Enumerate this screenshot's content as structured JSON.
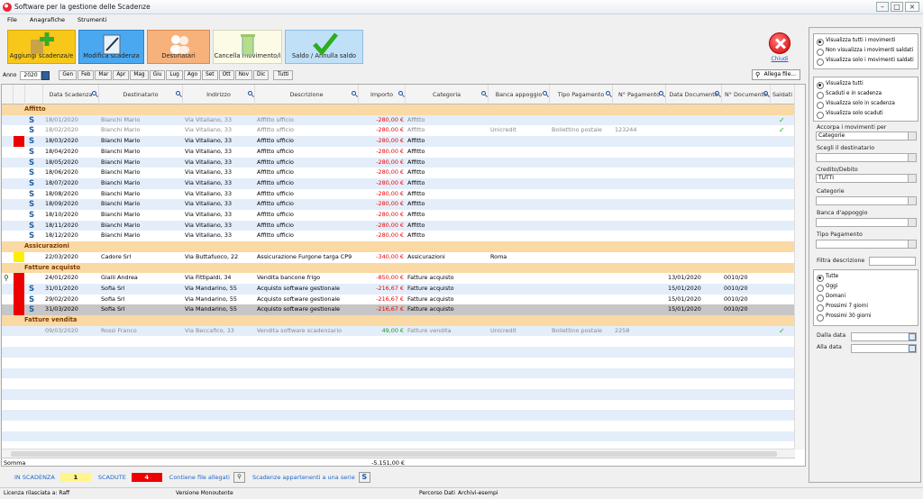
{
  "window": {
    "title": "Software per la gestione delle Scadenze"
  },
  "menu": [
    "File",
    "Anagrafiche",
    "Strumenti"
  ],
  "toolbar": {
    "add": "Aggiungi scadenza/e",
    "edit": "Modifica scadenza",
    "recipients": "Destinatari",
    "delete": "Cancella movimento/i",
    "settle": "Saldo / Annulla saldo",
    "close": "Chiudi"
  },
  "yearbar": {
    "label": "Anno",
    "year": "2020",
    "months": [
      "Gen",
      "Feb",
      "Mar",
      "Apr",
      "Mag",
      "Giu",
      "Lug",
      "Ago",
      "Set",
      "Ott",
      "Nov",
      "Dic"
    ],
    "all": "Tutti",
    "attach": "Allega file..."
  },
  "columns": [
    "Data Scadenza",
    "Destinatario",
    "Indirizzo",
    "Descrizione",
    "Importo",
    "Categoria",
    "Banca appoggio",
    "Tipo Pagamento",
    "N° Pagamento",
    "Data Documento",
    "N° Documento",
    "Saldati"
  ],
  "groups": [
    "Affitto",
    "Assicurazioni",
    "Fatture acquisto",
    "Fatture vendita"
  ],
  "rows": [
    {
      "g": 0,
      "date": "18/01/2020",
      "dest": "Bianchi Mario",
      "addr": "Via Vitaliano, 33",
      "desc": "Affitto ufficio",
      "amt": "-280,00 €",
      "cat": "Affitto",
      "bank": "",
      "tipo": "",
      "npag": "",
      "ddoc": "",
      "ndoc": "",
      "paid": true,
      "flag": "",
      "series": true
    },
    {
      "g": 0,
      "date": "18/02/2020",
      "dest": "Bianchi Mario",
      "addr": "Via Vitaliano, 33",
      "desc": "Affitto ufficio",
      "amt": "-280,00 €",
      "cat": "Affitto",
      "bank": "Unicredit",
      "tipo": "Bollettino postale",
      "npag": "123244",
      "ddoc": "",
      "ndoc": "",
      "paid": true,
      "flag": "",
      "series": true
    },
    {
      "g": 0,
      "date": "18/03/2020",
      "dest": "Bianchi Mario",
      "addr": "Via Vitaliano, 33",
      "desc": "Affitto ufficio",
      "amt": "-280,00 €",
      "cat": "Affitto",
      "bank": "",
      "tipo": "",
      "npag": "",
      "ddoc": "",
      "ndoc": "",
      "paid": false,
      "flag": "#ee0000",
      "series": true
    },
    {
      "g": 0,
      "date": "18/04/2020",
      "dest": "Bianchi Mario",
      "addr": "Via Vitaliano, 33",
      "desc": "Affitto ufficio",
      "amt": "-280,00 €",
      "cat": "Affitto",
      "bank": "",
      "tipo": "",
      "npag": "",
      "ddoc": "",
      "ndoc": "",
      "paid": false,
      "flag": "",
      "series": true
    },
    {
      "g": 0,
      "date": "18/05/2020",
      "dest": "Bianchi Mario",
      "addr": "Via Vitaliano, 33",
      "desc": "Affitto ufficio",
      "amt": "-280,00 €",
      "cat": "Affitto",
      "bank": "",
      "tipo": "",
      "npag": "",
      "ddoc": "",
      "ndoc": "",
      "paid": false,
      "flag": "",
      "series": true
    },
    {
      "g": 0,
      "date": "18/06/2020",
      "dest": "Bianchi Mario",
      "addr": "Via Vitaliano, 33",
      "desc": "Affitto ufficio",
      "amt": "-280,00 €",
      "cat": "Affitto",
      "bank": "",
      "tipo": "",
      "npag": "",
      "ddoc": "",
      "ndoc": "",
      "paid": false,
      "flag": "",
      "series": true
    },
    {
      "g": 0,
      "date": "18/07/2020",
      "dest": "Bianchi Mario",
      "addr": "Via Vitaliano, 33",
      "desc": "Affitto ufficio",
      "amt": "-280,00 €",
      "cat": "Affitto",
      "bank": "",
      "tipo": "",
      "npag": "",
      "ddoc": "",
      "ndoc": "",
      "paid": false,
      "flag": "",
      "series": true
    },
    {
      "g": 0,
      "date": "18/08/2020",
      "dest": "Bianchi Mario",
      "addr": "Via Vitaliano, 33",
      "desc": "Affitto ufficio",
      "amt": "-280,00 €",
      "cat": "Affitto",
      "bank": "",
      "tipo": "",
      "npag": "",
      "ddoc": "",
      "ndoc": "",
      "paid": false,
      "flag": "",
      "series": true
    },
    {
      "g": 0,
      "date": "18/09/2020",
      "dest": "Bianchi Mario",
      "addr": "Via Vitaliano, 33",
      "desc": "Affitto ufficio",
      "amt": "-280,00 €",
      "cat": "Affitto",
      "bank": "",
      "tipo": "",
      "npag": "",
      "ddoc": "",
      "ndoc": "",
      "paid": false,
      "flag": "",
      "series": true
    },
    {
      "g": 0,
      "date": "18/10/2020",
      "dest": "Bianchi Mario",
      "addr": "Via Vitaliano, 33",
      "desc": "Affitto ufficio",
      "amt": "-280,00 €",
      "cat": "Affitto",
      "bank": "",
      "tipo": "",
      "npag": "",
      "ddoc": "",
      "ndoc": "",
      "paid": false,
      "flag": "",
      "series": true
    },
    {
      "g": 0,
      "date": "18/11/2020",
      "dest": "Bianchi Mario",
      "addr": "Via Vitaliano, 33",
      "desc": "Affitto ufficio",
      "amt": "-280,00 €",
      "cat": "Affitto",
      "bank": "",
      "tipo": "",
      "npag": "",
      "ddoc": "",
      "ndoc": "",
      "paid": false,
      "flag": "",
      "series": true
    },
    {
      "g": 0,
      "date": "18/12/2020",
      "dest": "Bianchi Mario",
      "addr": "Via Vitaliano, 33",
      "desc": "Affitto ufficio",
      "amt": "-280,00 €",
      "cat": "Affitto",
      "bank": "",
      "tipo": "",
      "npag": "",
      "ddoc": "",
      "ndoc": "",
      "paid": false,
      "flag": "",
      "series": true
    },
    {
      "g": 1,
      "date": "22/03/2020",
      "dest": "Cadore Srl",
      "addr": "Via Buttafuoco, 22",
      "desc": "Assicurazione Furgone targa CP9",
      "amt": "-340,00 €",
      "cat": "Assicurazioni",
      "bank": "Roma",
      "tipo": "",
      "npag": "",
      "ddoc": "",
      "ndoc": "",
      "paid": false,
      "flag": "#ffee00",
      "series": false
    },
    {
      "g": 2,
      "date": "24/01/2020",
      "dest": "Gialli Andrea",
      "addr": "Via Fittipaldi, 34",
      "desc": "Vendita bancone frigo",
      "amt": "-850,00 €",
      "cat": "Fatture acquisto",
      "bank": "",
      "tipo": "",
      "npag": "",
      "ddoc": "13/01/2020",
      "ndoc": "0010/20",
      "paid": false,
      "flag": "#ee0000",
      "series": false,
      "attach": true
    },
    {
      "g": 2,
      "date": "31/01/2020",
      "dest": "Sofia Srl",
      "addr": "Via Mandarino, 55",
      "desc": "Acquisto software gestionale",
      "amt": "-216,67 €",
      "cat": "Fatture acquisto",
      "bank": "",
      "tipo": "",
      "npag": "",
      "ddoc": "15/01/2020",
      "ndoc": "0010/20",
      "paid": false,
      "flag": "#ee0000",
      "series": true
    },
    {
      "g": 2,
      "date": "29/02/2020",
      "dest": "Sofia Srl",
      "addr": "Via Mandarino, 55",
      "desc": "Acquisto software gestionale",
      "amt": "-216,67 €",
      "cat": "Fatture acquisto",
      "bank": "",
      "tipo": "",
      "npag": "",
      "ddoc": "15/01/2020",
      "ndoc": "0010/20",
      "paid": false,
      "flag": "#ee0000",
      "series": true
    },
    {
      "g": 2,
      "date": "31/03/2020",
      "dest": "Sofia Srl",
      "addr": "Via Mandarino, 55",
      "desc": "Acquisto software gestionale",
      "amt": "-216,67 €",
      "cat": "Fatture acquisto",
      "bank": "",
      "tipo": "",
      "npag": "",
      "ddoc": "15/01/2020",
      "ndoc": "0010/20",
      "paid": false,
      "flag": "#ee0000",
      "series": true,
      "selected": true
    },
    {
      "g": 3,
      "date": "09/03/2020",
      "dest": "Rossi Franco",
      "addr": "Via Beccafico, 33",
      "desc": "Vendita software scadenzario",
      "amt": "49,00 €",
      "cat": "Fatture vendita",
      "bank": "Unicredit",
      "tipo": "Bollettino postale",
      "npag": "2258",
      "ddoc": "",
      "ndoc": "",
      "paid": true,
      "flag": "",
      "series": false,
      "positive": true
    }
  ],
  "sum": {
    "label": "Somma",
    "value": "-5.151,00 €"
  },
  "legend": {
    "due": "IN SCADENZA",
    "due_count": "1",
    "expired": "SCADUTE",
    "expired_count": "4",
    "attach": "Contiene file allegati",
    "series": "Scadenze appartenenti a una serie"
  },
  "status": [
    "Licenza rilasciata a: Raff",
    "Versione Monoutente",
    "Percorso Dati",
    "Archivi-esempi"
  ],
  "side": {
    "view": [
      "Visualizza tutti i movimenti",
      "Non visualizza i movimenti saldati",
      "Visualizza solo i movimenti saldati"
    ],
    "filter": [
      "Visualizza tutti",
      "Scaduti e in scadenza",
      "Visualizza solo in scadenza",
      "Visualizza solo scaduti"
    ],
    "group_label": "Accorpa i movimenti per",
    "group_value": "Categorie",
    "dest_label": "Scegli il destinatario",
    "credit_label": "Credito/Debito",
    "credit_value": "TUTTI",
    "cat_label": "Categorie",
    "bank_label": "Banca d'appoggio",
    "tipo_label": "Tipo Pagamento",
    "desc_label": "Filtra descrizione",
    "period": [
      "Tutte",
      "Oggi",
      "Domani",
      "Prossimi 7 giorni",
      "Prossimi 30 giorni"
    ],
    "from_label": "Dalla data",
    "to_label": "Alla data"
  },
  "colors": {
    "due": "#ffee00",
    "expired": "#ee0000",
    "group": "#fbd9a4",
    "alt": "#e4eefa"
  }
}
